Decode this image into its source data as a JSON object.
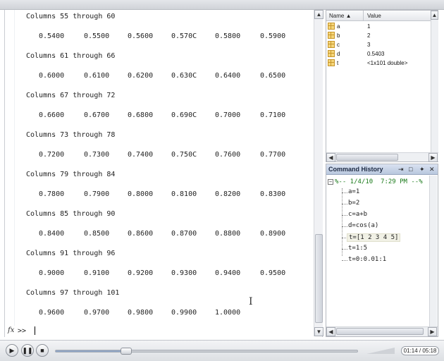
{
  "command_window": {
    "blocks": [
      {
        "header": "Columns 55 through 60",
        "values": [
          "0.5400",
          "0.5500",
          "0.5600",
          "0.570C",
          "0.5800",
          "0.5900"
        ]
      },
      {
        "header": "Columns 61 through 66",
        "values": [
          "0.6000",
          "0.6100",
          "0.6200",
          "0.630C",
          "0.6400",
          "0.6500"
        ]
      },
      {
        "header": "Columns 67 through 72",
        "values": [
          "0.6600",
          "0.6700",
          "0.6800",
          "0.690C",
          "0.7000",
          "0.7100"
        ]
      },
      {
        "header": "Columns 73 through 78",
        "values": [
          "0.7200",
          "0.7300",
          "0.7400",
          "0.750C",
          "0.7600",
          "0.7700"
        ]
      },
      {
        "header": "Columns 79 through 84",
        "values": [
          "0.7800",
          "0.7900",
          "0.8000",
          "0.8100",
          "0.8200",
          "0.8300"
        ]
      },
      {
        "header": "Columns 85 through 90",
        "values": [
          "0.8400",
          "0.8500",
          "0.8600",
          "0.8700",
          "0.8800",
          "0.8900"
        ]
      },
      {
        "header": "Columns 91 through 96",
        "values": [
          "0.9000",
          "0.9100",
          "0.9200",
          "0.9300",
          "0.9400",
          "0.9500"
        ]
      },
      {
        "header": "Columns 97 through 101",
        "values": [
          "0.9600",
          "0.9700",
          "0.9800",
          "0.9900",
          "1.0000"
        ]
      }
    ],
    "fx_label": "fx",
    "prompt": ">>"
  },
  "workspace": {
    "name_header": "Name ▲",
    "value_header": "Value",
    "variables": [
      {
        "name": "a",
        "value": "1"
      },
      {
        "name": "b",
        "value": "2"
      },
      {
        "name": "c",
        "value": "3"
      },
      {
        "name": "d",
        "value": "0.5403"
      },
      {
        "name": "t",
        "value": "<1x101 double>"
      }
    ]
  },
  "command_history": {
    "title": "Command History",
    "session": "%-- 1/4/10  7:29 PM --%",
    "items": [
      "a=1",
      "b=2",
      "c=a+b",
      "d=cos(a)",
      "t=[1 2 3 4 5]",
      "t=1:5",
      "t=0:0.01:1"
    ],
    "highlighted_index": 4
  },
  "player": {
    "time": "01:14 / 05:18",
    "progress": 0.2327
  }
}
